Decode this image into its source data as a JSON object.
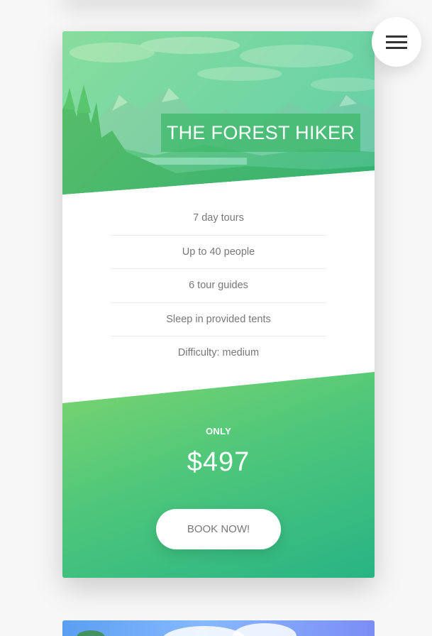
{
  "menu": {
    "icon": "hamburger-icon"
  },
  "card": {
    "title": "THE FOREST HIKER",
    "features": [
      "7 day tours",
      "Up to 40 people",
      "6 tour guides",
      "Sleep in provided tents",
      "Difficulty: medium"
    ],
    "price_prefix": "ONLY",
    "price": "$497",
    "cta_label": "BOOK NOW!"
  },
  "colors": {
    "accent_light": "#7dd56f",
    "accent_dark": "#28b485",
    "text_gray": "#777777",
    "background": "#f7f7f7"
  }
}
